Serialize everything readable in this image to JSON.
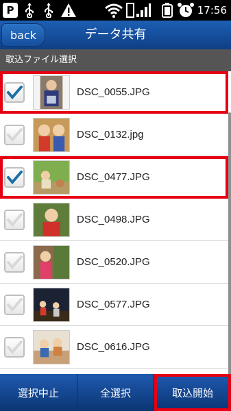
{
  "status_bar": {
    "time": "17:56",
    "p_label": "P",
    "icons": [
      "p-icon",
      "usb-icon",
      "usb-icon",
      "warning-icon",
      "wifi-icon",
      "signal-icon",
      "battery-icon",
      "alarm-icon"
    ]
  },
  "header": {
    "back_label": "back",
    "title": "データ共有"
  },
  "section": {
    "label": "取込ファイル選択"
  },
  "files": [
    {
      "name": "DSC_0055.JPG",
      "checked": true
    },
    {
      "name": "DSC_0132.jpg",
      "checked": false
    },
    {
      "name": "DSC_0477.JPG",
      "checked": true
    },
    {
      "name": "DSC_0498.JPG",
      "checked": false
    },
    {
      "name": "DSC_0520.JPG",
      "checked": false
    },
    {
      "name": "DSC_0577.JPG",
      "checked": false
    },
    {
      "name": "DSC_0616.JPG",
      "checked": false
    }
  ],
  "bottom_bar": {
    "cancel_label": "選択中止",
    "select_all_label": "全選択",
    "start_label": "取込開始"
  },
  "colors": {
    "highlight": "#e60012",
    "header_blue": "#1d5fb4",
    "check_blue": "#1c6fa8"
  }
}
